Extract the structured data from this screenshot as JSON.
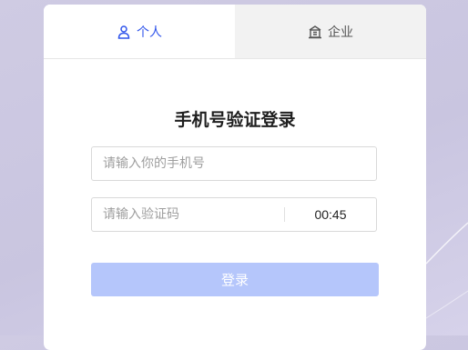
{
  "tabs": [
    {
      "label": "个人",
      "icon": "user-icon",
      "active": true
    },
    {
      "label": "企业",
      "icon": "building-icon",
      "active": false
    }
  ],
  "form": {
    "title": "手机号验证登录",
    "phone_placeholder": "请输入你的手机号",
    "phone_value": "",
    "code_placeholder": "请输入验证码",
    "code_value": "",
    "countdown": "00:45",
    "login_label": "登录"
  },
  "colors": {
    "accent": "#2f54eb",
    "button_disabled": "#b5c6fb",
    "background": "#cfcbe3"
  }
}
